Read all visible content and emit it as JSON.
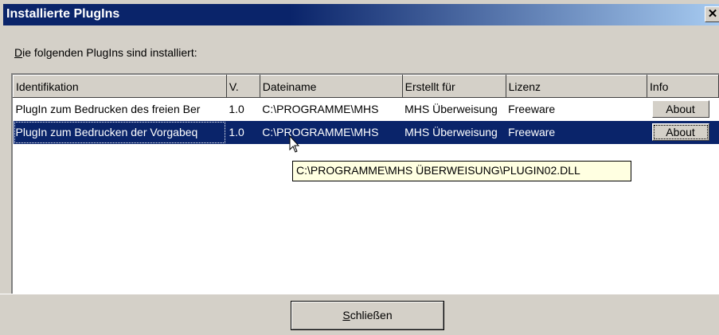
{
  "window": {
    "title": "Installierte PlugIns",
    "close_symbol": "✕"
  },
  "intro": {
    "mnemonic": "D",
    "text": "ie folgenden PlugIns sind installiert:"
  },
  "columns": [
    "Identifikation",
    "V.",
    "Dateiname",
    "Erstellt für",
    "Lizenz",
    "Info"
  ],
  "rows": [
    {
      "identifikation": "PlugIn zum Bedrucken des freien Ber",
      "version": "1.0",
      "dateiname": "C:\\PROGRAMME\\MHS",
      "erstellt_fuer": "MHS Überweisung",
      "lizenz": "Freeware",
      "info_button": "About",
      "selected": false
    },
    {
      "identifikation": "PlugIn zum Bedrucken der Vorgabeq",
      "version": "1.0",
      "dateiname": "C:\\PROGRAMME\\MHS",
      "erstellt_fuer": "MHS Überweisung",
      "lizenz": "Freeware",
      "info_button": "About",
      "selected": true
    }
  ],
  "tooltip": "C:\\PROGRAMME\\MHS ÜBERWEISUNG\\PLUGIN02.DLL",
  "close_button": {
    "mnemonic": "S",
    "text": "chließen"
  },
  "colors": {
    "title_gradient_start": "#0a246a",
    "title_gradient_end": "#a6caf0",
    "selection": "#0a246a",
    "tooltip_bg": "#ffffe1",
    "face": "#d4d0c8"
  },
  "icons": {
    "cursor": "arrow-pointer-icon"
  }
}
